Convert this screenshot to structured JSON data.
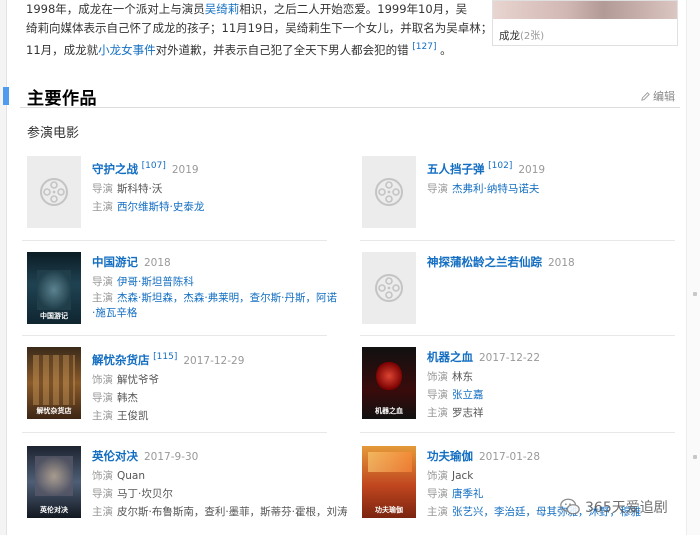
{
  "intro": {
    "line1_prefix": "1998年，成龙在一个派对上与演员",
    "line1_link": "吴绮莉",
    "line1_suffix": "相识，之后二人开始恋爱。1999年10月，吴",
    "line2": "绮莉向媒体表示自己怀了成龙的孩子；11月19日，吴绮莉生下一个女儿，并取名为吴卓林；",
    "line3_prefix": "11月，成龙就",
    "line3_link": "小龙女事件",
    "line3_suffix": "对外道歉，并表示自己犯了全天下男人都会犯的错",
    "line3_ref": "[127]",
    "line3_end": "。"
  },
  "photo_card": {
    "caption": "成龙",
    "count": "(2张)"
  },
  "section": {
    "title": "主要作品",
    "edit_label": "编辑",
    "subheading": "参演电影"
  },
  "films": [
    {
      "title": "守护之战",
      "ref": "[107]",
      "year": "2019",
      "rows": [
        {
          "label": "导演",
          "value": "斯科特·沃",
          "link": false
        },
        {
          "label": "主演",
          "value": "西尔维斯特·史泰龙",
          "link": true
        }
      ]
    },
    {
      "title": "五人挡子弹",
      "ref": "[102]",
      "year": "2019",
      "rows": [
        {
          "label": "导演",
          "value": "杰弗利·纳特马诺夫",
          "link": true
        }
      ]
    },
    {
      "title": "中国游记",
      "ref": "",
      "year": "2018",
      "rows": [
        {
          "label": "导演",
          "value": "伊哥·斯坦普陈科",
          "link": true
        },
        {
          "label": "主演",
          "value": "杰森·斯坦森，杰森·弗莱明，查尔斯·丹斯，阿诺·施瓦辛格",
          "link": true
        }
      ]
    },
    {
      "title": "神探蒲松龄之兰若仙踪",
      "ref": "",
      "year": "2018",
      "rows": []
    },
    {
      "title": "解忧杂货店",
      "ref": "[115]",
      "year": "2017-12-29",
      "rows": [
        {
          "label": "饰演",
          "value": "解忧爷爷",
          "link": false
        },
        {
          "label": "导演",
          "value": "韩杰",
          "link": false
        },
        {
          "label": "主演",
          "value": "王俊凯",
          "link": false
        }
      ]
    },
    {
      "title": "机器之血",
      "ref": "",
      "year": "2017-12-22",
      "rows": [
        {
          "label": "饰演",
          "value": "林东",
          "link": false
        },
        {
          "label": "导演",
          "value": "张立嘉",
          "link": true
        },
        {
          "label": "主演",
          "value": "罗志祥",
          "link": false
        }
      ]
    },
    {
      "title": "英伦对决",
      "ref": "",
      "year": "2017-9-30",
      "rows": [
        {
          "label": "饰演",
          "value": "Quan",
          "link": false
        },
        {
          "label": "导演",
          "value": "马丁·坎贝尔",
          "link": false
        },
        {
          "label": "主演",
          "value": "皮尔斯·布鲁斯南，查利·墨菲，斯蒂芬·霍根，刘涛",
          "link": false
        }
      ]
    },
    {
      "title": "功夫瑜伽",
      "ref": "",
      "year": "2017-01-28",
      "rows": [
        {
          "label": "饰演",
          "value": "Jack",
          "link": false
        },
        {
          "label": "导演",
          "value": "唐季礼",
          "link": true
        },
        {
          "label": "主演",
          "value": "张艺兴，李治廷，母其弥雅，沐野，穆雅",
          "link": true
        }
      ]
    }
  ],
  "posters": {
    "china": "中国游记",
    "jiey": "解忧杂货店",
    "blood": "机器之血",
    "bleed": "英伦对决",
    "kungfu": "功夫瑜伽"
  },
  "watermark": "365天爱追剧",
  "colors": {
    "link": "#136ec2",
    "accent_bar": "#4f9cee",
    "muted": "#999999"
  }
}
